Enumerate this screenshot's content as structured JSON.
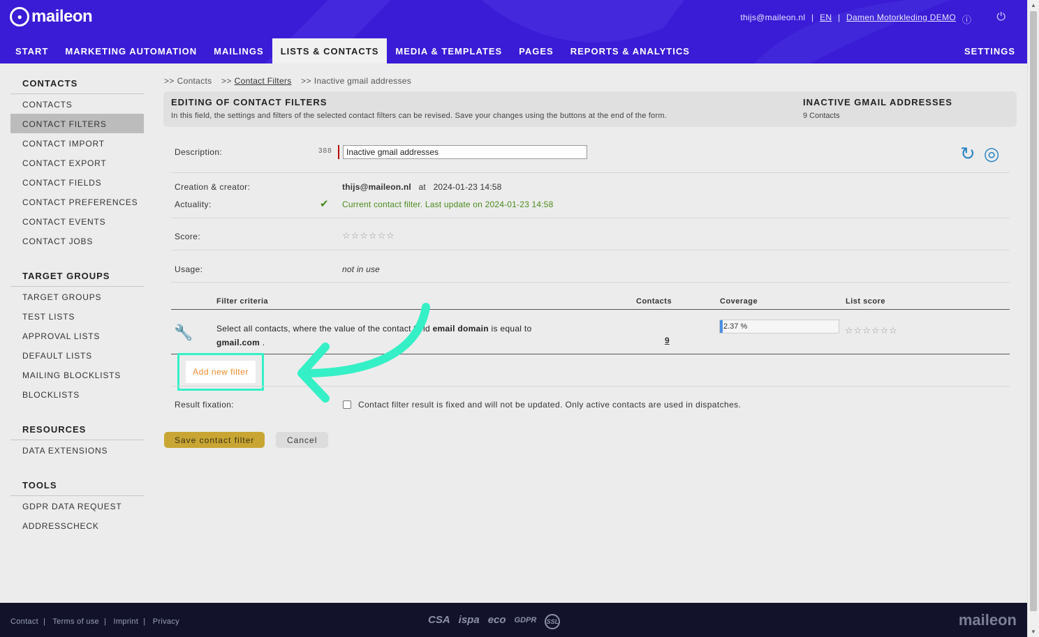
{
  "header": {
    "logo": "maileon",
    "user_email": "thijs@maileon.nl",
    "language": "EN",
    "account": "Damen Motorkleding DEMO",
    "nav": [
      "START",
      "MARKETING AUTOMATION",
      "MAILINGS",
      "LISTS & CONTACTS",
      "MEDIA & TEMPLATES",
      "PAGES",
      "REPORTS & ANALYTICS"
    ],
    "settings": "SETTINGS",
    "icons": [
      "info-icon",
      "power-icon"
    ]
  },
  "sidebar": {
    "contacts": {
      "title": "CONTACTS",
      "items": [
        "CONTACTS",
        "CONTACT FILTERS",
        "CONTACT IMPORT",
        "CONTACT EXPORT",
        "CONTACT FIELDS",
        "CONTACT PREFERENCES",
        "CONTACT EVENTS",
        "CONTACT JOBS"
      ]
    },
    "target_groups": {
      "title": "TARGET GROUPS",
      "items": [
        "TARGET GROUPS",
        "TEST LISTS",
        "APPROVAL LISTS",
        "DEFAULT LISTS",
        "MAILING BLOCKLISTS",
        "BLOCKLISTS"
      ]
    },
    "resources": {
      "title": "RESOURCES",
      "items": [
        "DATA EXTENSIONS"
      ]
    },
    "tools": {
      "title": "TOOLS",
      "items": [
        "GDPR DATA REQUEST",
        "ADDRESSCHECK"
      ]
    }
  },
  "breadcrumb": {
    "prefix": ">>",
    "items": [
      "Contacts",
      "Contact Filters",
      "Inactive gmail addresses"
    ]
  },
  "info": {
    "title": "EDITING OF CONTACT FILTERS",
    "description": "In this field, the settings and filters of the selected contact filters can be revised. Save your changes using the buttons at the end of the form.",
    "filter_name": "INACTIVE GMAIL ADDRESSES",
    "filter_count": "9 Contacts"
  },
  "form": {
    "description_label": "Description:",
    "description_counter": "388",
    "description_value": "Inactive gmail addresses",
    "creation_label": "Creation & creator:",
    "creator": "thijs@maileon.nl",
    "at": "at",
    "created": "2024-01-23 14:58",
    "actuality_label": "Actuality:",
    "actuality_value": "Current contact filter. Last update on 2024-01-23 14:58",
    "score_label": "Score:",
    "usage_label": "Usage:",
    "usage_value": "not in use",
    "fixation_label": "Result fixation:",
    "fixation_text": "Contact filter result is fixed and will not be updated. Only active contacts are used in dispatches.",
    "fixation_checked": false
  },
  "filters_table": {
    "headers": [
      "Filter criteria",
      "Contacts",
      "Coverage",
      "List score"
    ],
    "rows": [
      {
        "criteria_pre": "Select all contacts, where the value of the contact field",
        "field": "email domain",
        "criteria_mid": "is equal to",
        "value": "gmail.com",
        "criteria_end": ".",
        "contacts": "9",
        "coverage": "2.37 %",
        "coverage_fraction": 0.0237
      }
    ]
  },
  "buttons": {
    "add_filter": "Add new filter",
    "save": "Save contact filter",
    "cancel": "Cancel"
  },
  "stars": "☆☆☆☆☆☆",
  "footer": {
    "links": [
      "Contact",
      "Terms of use",
      "Imprint",
      "Privacy"
    ],
    "badges": [
      "CSA",
      "ispa",
      "eco",
      "GDPR",
      "SSL"
    ],
    "logo": "maileon"
  },
  "colors": {
    "header": "#3a1bd6",
    "highlight": "#35f0c6",
    "save_button": "#c9a634",
    "add_filter_text": "#f08a2c",
    "footer": "#12132a"
  }
}
